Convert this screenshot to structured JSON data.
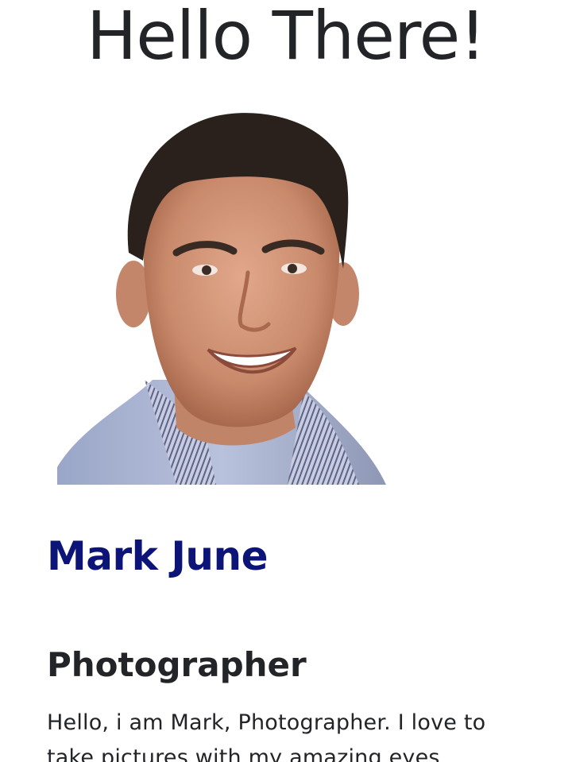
{
  "heading": "Hello There!",
  "profile": {
    "photo_name": "profile-photo",
    "name": "Mark June",
    "role": "Photographer",
    "bio": "Hello, i am Mark, Photographer. I love to take pictures with my amazing eyes"
  },
  "colors": {
    "name": "#0c1477",
    "text": "#222428",
    "background": "#ffffff"
  }
}
